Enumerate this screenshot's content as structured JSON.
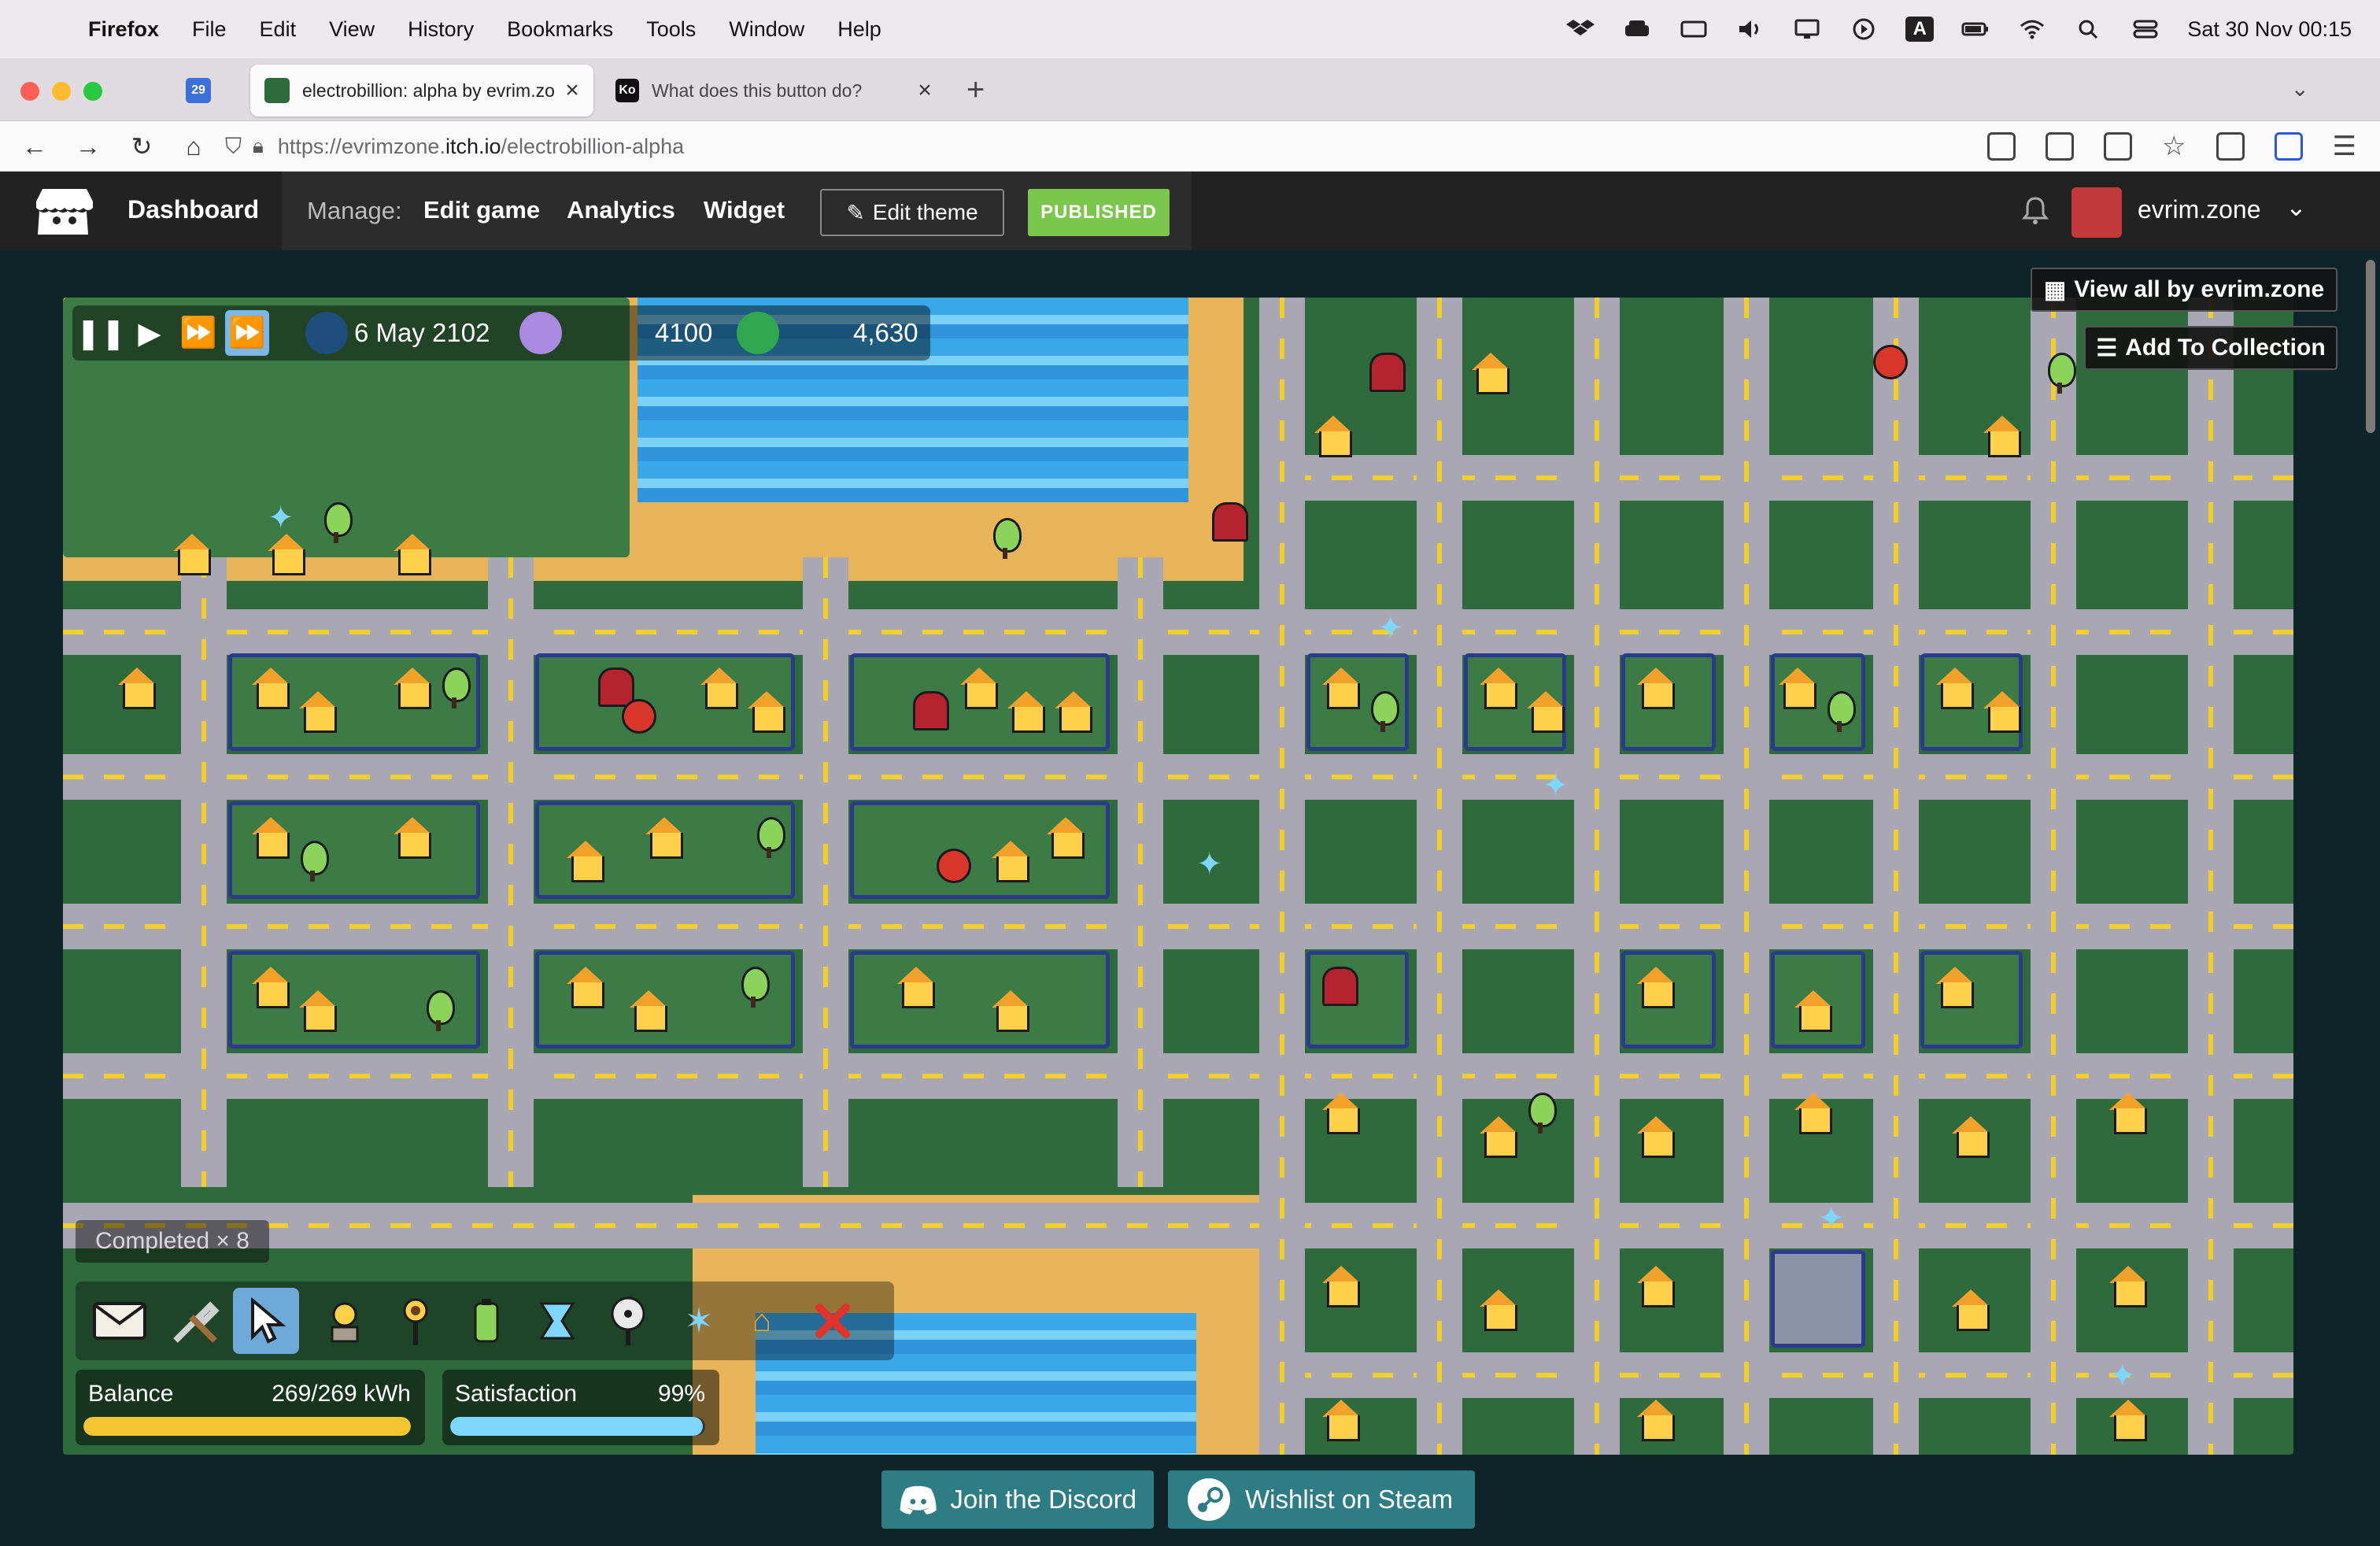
{
  "menubar": {
    "app": "Firefox",
    "items": [
      "File",
      "Edit",
      "View",
      "History",
      "Bookmarks",
      "Tools",
      "Window",
      "Help"
    ],
    "input_badge": "A",
    "clock": "Sat 30 Nov  00:15"
  },
  "tabs": [
    {
      "label": "29",
      "kind": "pinned"
    },
    {
      "label": "electrobillion: alpha by evrim.zo",
      "active": true
    },
    {
      "label": "What does this button do?",
      "favicon": "Ko"
    }
  ],
  "url": {
    "pre": "https://evrimzone.",
    "host": "itch.io",
    "path": "/electrobillion-alpha"
  },
  "itch": {
    "dashboard": "Dashboard",
    "manage": "Manage:",
    "links": [
      "Edit game",
      "Analytics",
      "Widget"
    ],
    "edit_theme": "Edit theme",
    "published": "PUBLISHED",
    "username": "evrim.zone",
    "view_all": "View all by evrim.zone",
    "add_collection": "Add To Collection"
  },
  "hud": {
    "date": "6 May 2102",
    "population": "4100",
    "money": "4,630",
    "completed": "Completed × 8",
    "balance_label": "Balance",
    "balance_value": "269/269 kWh",
    "balance_fraction": 1.0,
    "satisfaction_label": "Satisfaction",
    "satisfaction_value": "99%",
    "satisfaction_fraction": 0.99
  },
  "buttons": {
    "discord": "Join the Discord",
    "steam": "Wishlist on Steam"
  },
  "colors": {
    "itch_green": "#7bc74d",
    "teal": "#2e7d84",
    "balance_bar": "#f5c431",
    "satisfaction_bar": "#7fd6ff"
  }
}
